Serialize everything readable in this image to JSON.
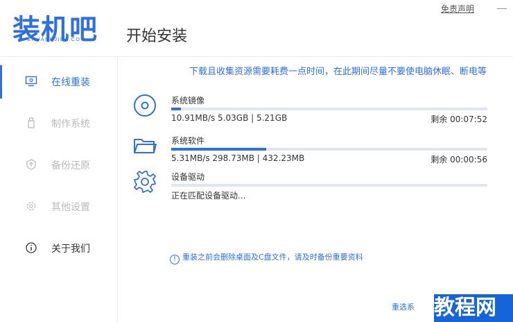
{
  "header": {
    "logo_text": "装机吧",
    "logo_sub": "ZHUANGJIBA.COM",
    "page_title": "开始安装",
    "disclaimer_label": "免责声明",
    "close_glyph": "—"
  },
  "sidebar": {
    "items": [
      {
        "label": "在线重装",
        "icon": "monitor-icon"
      },
      {
        "label": "制作系统",
        "icon": "usb-icon"
      },
      {
        "label": "备份还原",
        "icon": "backup-icon"
      },
      {
        "label": "其他设置",
        "icon": "gear-icon"
      },
      {
        "label": "关于我们",
        "icon": "info-icon"
      }
    ]
  },
  "main": {
    "notice": "下载且收集资源需要耗费一点时间，在此期间尽量不要使电脑休眠、断电等",
    "tasks": [
      {
        "name": "系统镜像",
        "detail": "10.91MB/s 5.03GB | 5.21GB",
        "remaining": "剩余 00:07:52",
        "progress": 0.03,
        "icon": "disc-icon"
      },
      {
        "name": "系统软件",
        "detail": "5.31MB/s 298.73MB | 432.23MB",
        "remaining": "剩余 00:00:56",
        "progress": 0.3,
        "icon": "folder-icon"
      },
      {
        "name": "设备驱动",
        "detail": "正在匹配设备驱动...",
        "remaining": "",
        "progress": 0,
        "icon": "gear-icon"
      }
    ],
    "tip_icon": "!",
    "tip": "重装之前会删除桌面及C盘文件，请及时备份重要资料",
    "bottom_link": "重选系",
    "watermark": "教程网"
  },
  "colors": {
    "accent": "#2f6fe0",
    "track": "#dfe6ef",
    "muted": "#bbbbbb"
  }
}
